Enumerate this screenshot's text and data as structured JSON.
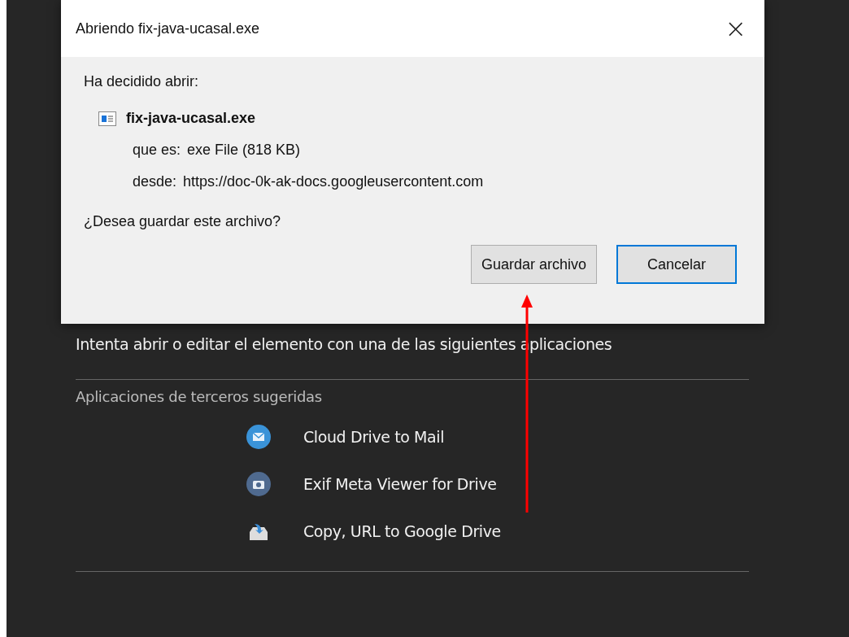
{
  "dialog": {
    "title": "Abriendo fix-java-ucasal.exe",
    "close": "×",
    "intro": "Ha decidido abrir:",
    "file_name": "fix-java-ucasal.exe",
    "details": [
      {
        "label": "que es:",
        "value": "exe File (818 KB)"
      },
      {
        "label": "desde:",
        "value": "https://doc-0k-ak-docs.googleusercontent.com"
      }
    ],
    "question": "¿Desea guardar este archivo?",
    "buttons": [
      {
        "label": "Guardar archivo",
        "focused": false
      },
      {
        "label": "Cancelar",
        "focused": true
      }
    ]
  },
  "page": {
    "message": "Intenta abrir o editar el elemento con una de las siguientes aplicaciones",
    "section_title": "Aplicaciones de terceros sugeridas",
    "apps": [
      {
        "kind": "mail",
        "name": "Cloud Drive to Mail"
      },
      {
        "kind": "camera",
        "name": "Exif Meta Viewer for Drive"
      },
      {
        "kind": "tray",
        "name": "Copy, URL to Google Drive"
      }
    ]
  }
}
